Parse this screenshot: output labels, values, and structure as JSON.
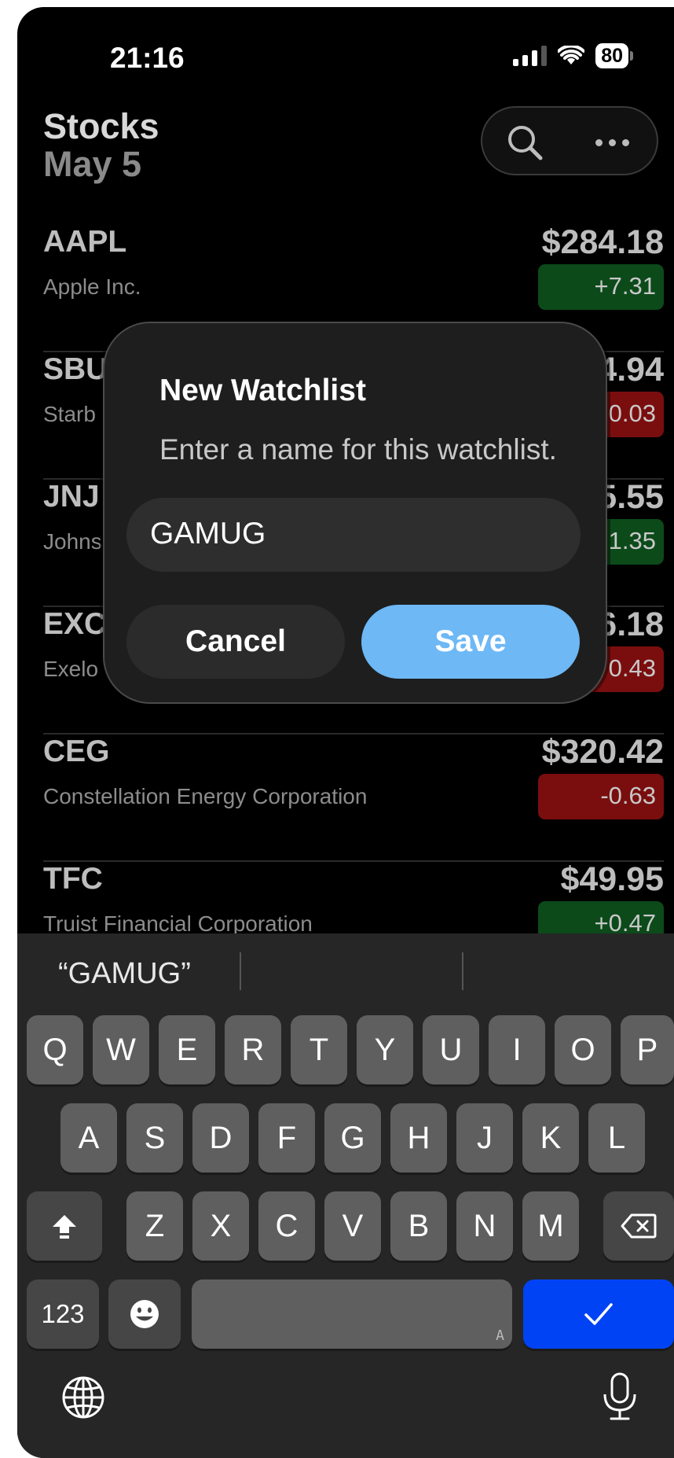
{
  "status_bar": {
    "time": "21:16",
    "battery": "80"
  },
  "header": {
    "title": "Stocks",
    "subtitle": "May 5"
  },
  "stocks": [
    {
      "symbol": "AAPL",
      "name": "Apple Inc.",
      "price": "$284.18",
      "change": "+7.31",
      "direction": "up"
    },
    {
      "symbol": "SBU",
      "name": "Starb",
      "price": "4.94",
      "change": "0.03",
      "direction": "down"
    },
    {
      "symbol": "JNJ",
      "name": "Johns",
      "price": "5.55",
      "change": "1.35",
      "direction": "up"
    },
    {
      "symbol": "EXC",
      "name": "Exelo",
      "price": "6.18",
      "change": "0.43",
      "direction": "down"
    },
    {
      "symbol": "CEG",
      "name": "Constellation Energy Corporation",
      "price": "$320.42",
      "change": "-0.63",
      "direction": "down"
    },
    {
      "symbol": "TFC",
      "name": "Truist Financial Corporation",
      "price": "$49.95",
      "change": "+0.47",
      "direction": "up"
    }
  ],
  "dialog": {
    "title": "New Watchlist",
    "message": "Enter a name for this watchlist.",
    "input_value": "GAMUG",
    "cancel_label": "Cancel",
    "save_label": "Save"
  },
  "keyboard": {
    "suggestion": "“GAMUG”",
    "row1": [
      "Q",
      "W",
      "E",
      "R",
      "T",
      "Y",
      "U",
      "I",
      "O",
      "P"
    ],
    "row2": [
      "A",
      "S",
      "D",
      "F",
      "G",
      "H",
      "J",
      "K",
      "L"
    ],
    "row3": [
      "Z",
      "X",
      "C",
      "V",
      "B",
      "N",
      "M"
    ],
    "numbers_label": "123",
    "space_hint": "A",
    "done_color": "#0043f5",
    "icons": [
      "shift-icon",
      "delete-icon",
      "emoji-icon",
      "checkmark-icon",
      "globe-icon",
      "microphone-icon"
    ]
  },
  "colors": {
    "positive": "#0c4a1a",
    "negative": "#7a0e0e",
    "save_button": "#6db8f5"
  }
}
